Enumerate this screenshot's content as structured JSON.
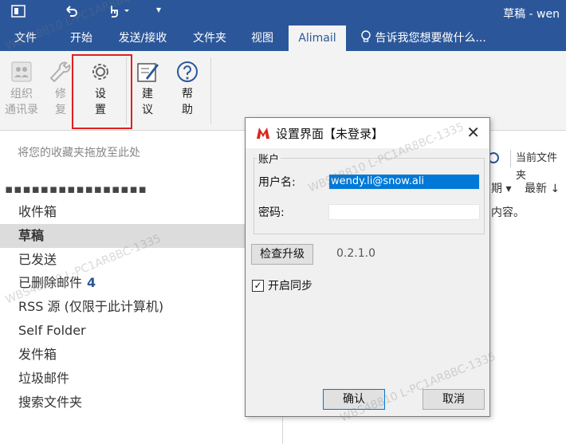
{
  "window": {
    "title": "草稿 - wen"
  },
  "quick_access": {
    "undo_icon": "undo-icon",
    "touch_icon": "touch-mode-icon",
    "customize_icon": "customize-qat-icon"
  },
  "tabs": [
    {
      "label": "文件"
    },
    {
      "label": "开始"
    },
    {
      "label": "发送/接收"
    },
    {
      "label": "文件夹"
    },
    {
      "label": "视图"
    },
    {
      "label": "Alimail"
    }
  ],
  "tellme": "告诉我您想要做什么...",
  "ribbon": {
    "contacts": {
      "line1": "组织",
      "line2": "通讯录"
    },
    "repair": {
      "line1": "修",
      "line2": "复"
    },
    "settings": {
      "line1": "设",
      "line2": "置"
    },
    "suggest": {
      "line1": "建",
      "line2": "议"
    },
    "help": {
      "line1": "帮",
      "line2": "助"
    }
  },
  "left_pane": {
    "favorites_hint": "将您的收藏夹拖放至此处",
    "account": "▪▪▪▪▪▪▪▪▪▪▪▪▪▪▪▪",
    "folders": [
      {
        "name": "收件箱"
      },
      {
        "name": "草稿"
      },
      {
        "name": "已发送"
      },
      {
        "name": "已删除邮件",
        "count": "4"
      },
      {
        "name": "RSS 源 (仅限于此计算机)"
      },
      {
        "name": "Self Folder"
      },
      {
        "name": "发件箱"
      },
      {
        "name": "垃圾邮件"
      },
      {
        "name": "搜索文件夹"
      }
    ]
  },
  "right_pane": {
    "search_scope": "当前文件夹",
    "filter_suffix": "期 ▾",
    "sort": "最新 ↓",
    "empty_text": "内容。"
  },
  "dialog": {
    "title": "设置界面【未登录】",
    "group_label": "账户",
    "username_label": "用户名:",
    "username_value": "wendy.li@snow.ali",
    "password_label": "密码:",
    "password_value": "",
    "check_upgrade": "检查升级",
    "version": "0.2.1.0",
    "sync_label": "开启同步",
    "sync_checked": "✓",
    "ok": "确认",
    "cancel": "取消"
  },
  "watermark": "WBS48810 L-PC1AR8BC-1335",
  "colors": {
    "brand": "#2b579a",
    "highlight": "#e02020",
    "alimail_red": "#d9261c"
  }
}
